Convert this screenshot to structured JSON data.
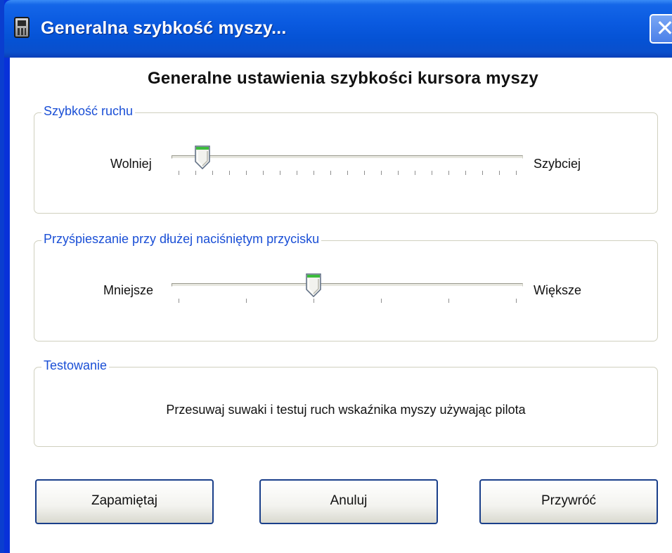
{
  "window": {
    "title": "Generalna szybkość myszy...",
    "close_symbol": "✕"
  },
  "heading": "Generalne ustawienia szybkości kursora myszy",
  "speed_group": {
    "label": "Szybkość ruchu",
    "min_label": "Wolniej",
    "max_label": "Szybciej",
    "value_fraction": 0.07,
    "tick_count": 21
  },
  "accel_group": {
    "label": "Przyśpieszanie przy dłużej naciśniętym przycisku",
    "min_label": "Mniejsze",
    "max_label": "Większe",
    "value_fraction": 0.4,
    "tick_count": 6
  },
  "test_group": {
    "label": "Testowanie",
    "text": "Przesuwaj suwaki i testuj ruch wskaźnika myszy używając pilota"
  },
  "buttons": {
    "save": "Zapamiętaj",
    "cancel": "Anuluj",
    "restore": "Przywróć"
  },
  "colors": {
    "titlebar": "#0552d4",
    "group_label": "#1a4fd6",
    "thumb_green": "#3cbc3c"
  },
  "icons": {
    "app": "remote-control-icon",
    "close": "close-icon"
  }
}
